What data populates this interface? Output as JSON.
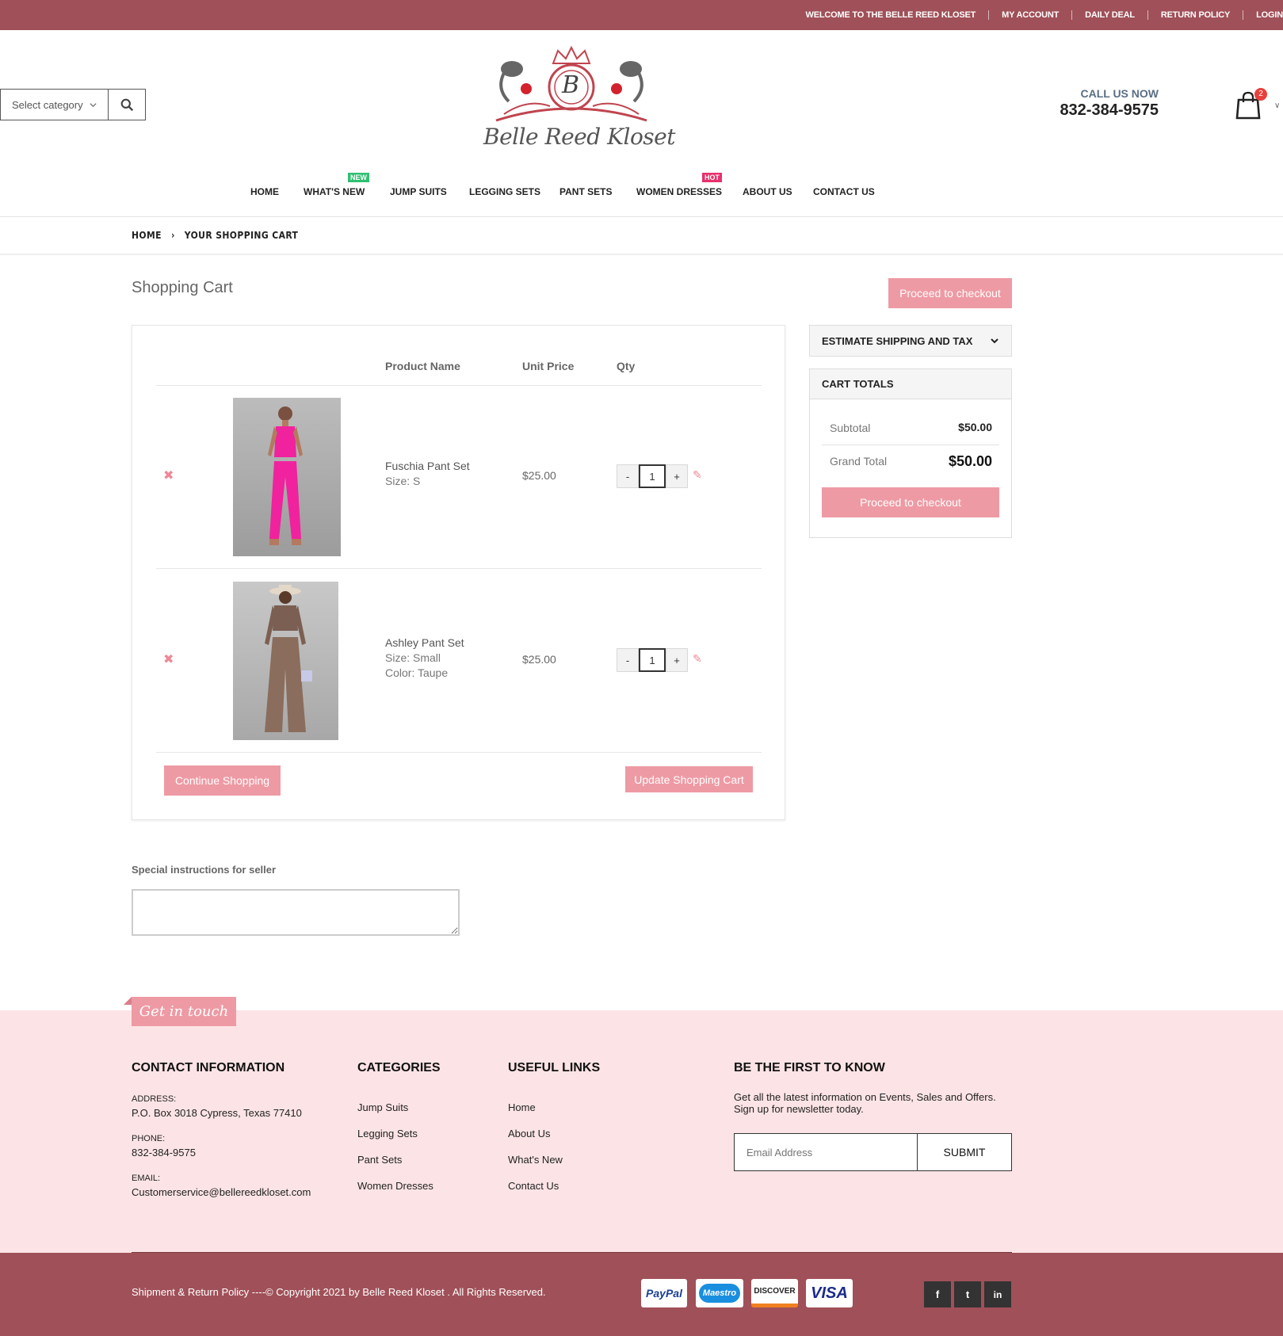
{
  "topbar": {
    "welcome": "WELCOME TO THE BELLE REED KLOSET",
    "links": [
      "MY ACCOUNT",
      "DAILY DEAL",
      "RETURN POLICY",
      "LOGIN"
    ]
  },
  "header": {
    "search": {
      "category_label": "Select category"
    },
    "logo": {
      "letter": "B",
      "name": "Belle Reed Kloset"
    },
    "call_label": "CALL US NOW",
    "phone": "832-384-9575",
    "cart_count": "2"
  },
  "nav": {
    "items": [
      "HOME",
      "WHAT'S NEW",
      "JUMP SUITS",
      "LEGGING SETS",
      "PANT SETS",
      "WOMEN DRESSES",
      "ABOUT US",
      "CONTACT US"
    ],
    "badge_new": "NEW",
    "badge_hot": "HOT",
    "badge_new_color": "#2fbf71",
    "badge_hot_color": "#e8306c"
  },
  "breadcrumb": {
    "home": "HOME",
    "sep": "›",
    "current": "YOUR SHOPPING CART"
  },
  "cart": {
    "title": "Shopping Cart",
    "checkout_top": "Proceed to checkout",
    "columns": {
      "name": "Product Name",
      "price": "Unit Price",
      "qty": "Qty"
    },
    "items": [
      {
        "name": "Fuschia Pant Set",
        "size": "Size: S",
        "price": "$25.00",
        "qty": "1"
      },
      {
        "name": "Ashley Pant Set",
        "size": "Size: Small",
        "color": "Color: Taupe",
        "price": "$25.00",
        "qty": "1"
      }
    ],
    "continue": "Continue Shopping",
    "update": "Update Shopping Cart",
    "special_label": "Special instructions for seller"
  },
  "sidebar": {
    "estimate": "ESTIMATE SHIPPING AND TAX",
    "totals_title": "CART TOTALS",
    "subtotal_label": "Subtotal",
    "subtotal": "$50.00",
    "grand_label": "Grand Total",
    "grand": "$50.00",
    "checkout": "Proceed to checkout"
  },
  "footer": {
    "get_in_touch": "Get in touch",
    "contact": {
      "title": "CONTACT INFORMATION",
      "address_label": "ADDRESS:",
      "address": "P.O. Box 3018 Cypress, Texas 77410",
      "phone_label": "PHONE:",
      "phone": "832-384-9575",
      "email_label": "EMAIL:",
      "email": "Customerservice@bellereedkloset.com"
    },
    "categories": {
      "title": "CATEGORIES",
      "items": [
        "Jump Suits",
        "Legging Sets",
        "Pant Sets",
        "Women Dresses"
      ]
    },
    "useful": {
      "title": "USEFUL LINKS",
      "items": [
        "Home",
        "About Us",
        "What's New",
        "Contact Us"
      ]
    },
    "newsletter": {
      "title": "BE THE FIRST TO KNOW",
      "text": "Get all the latest information on Events, Sales and Offers. Sign up for newsletter today.",
      "placeholder": "Email Address",
      "submit": "SUBMIT"
    },
    "copyright": "Shipment & Return Policy ----© Copyright 2021 by Belle Reed Kloset . All Rights Reserved.",
    "payments": [
      "PayPal",
      "Maestro",
      "DISCOVER",
      "VISA"
    ],
    "social": [
      "f",
      "t",
      "in"
    ]
  },
  "colors": {
    "brand": "#a05058",
    "accent": "#ee9aa4",
    "footer_bg": "#fce4e6"
  }
}
